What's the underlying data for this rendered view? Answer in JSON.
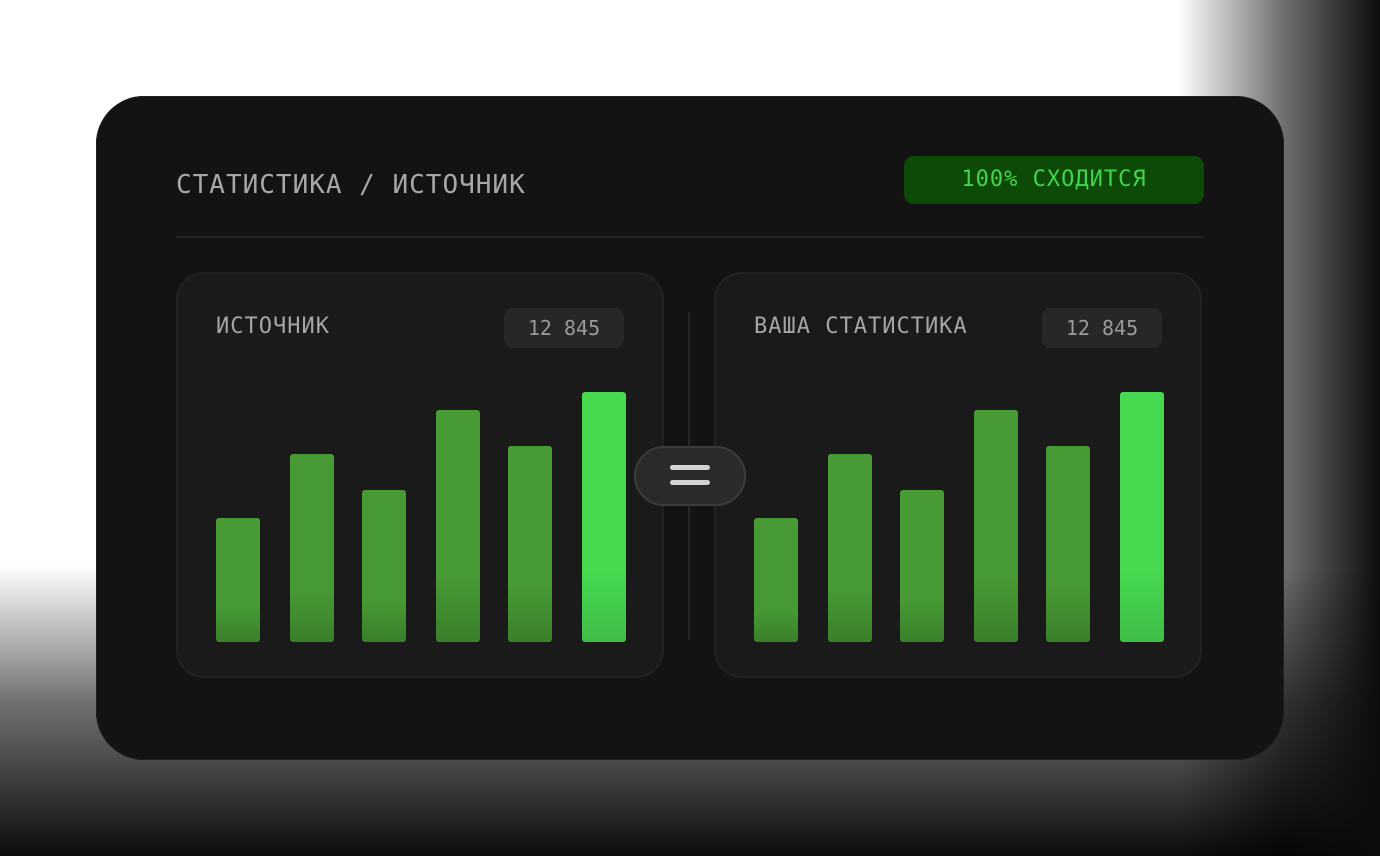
{
  "header": {
    "title": "СТАТИСТИКА / ИСТОЧНИК",
    "status_badge": "100% СХОДИТСЯ"
  },
  "colors": {
    "bar": "#489a34",
    "bar_bottom": "#3b7f2c",
    "bar_highlight": "#46d84f",
    "bar_highlight_bottom": "#3fbe47",
    "badge_bg": "#0d4a07",
    "badge_text": "#41d64a"
  },
  "compare_icon": "equals-icon",
  "panels": [
    {
      "label": "ИСТОЧНИК",
      "count": "12 845"
    },
    {
      "label": "ВАША СТАТИСТИКА",
      "count": "12 845"
    }
  ],
  "chart_data": [
    {
      "type": "bar",
      "values": [
        124,
        188,
        152,
        232,
        196,
        250
      ],
      "highlight_index": 5,
      "ylim": [
        0,
        250
      ],
      "xlabel": "",
      "ylabel": ""
    },
    {
      "type": "bar",
      "values": [
        124,
        188,
        152,
        232,
        196,
        250
      ],
      "highlight_index": 5,
      "ylim": [
        0,
        250
      ],
      "xlabel": "",
      "ylabel": ""
    }
  ]
}
